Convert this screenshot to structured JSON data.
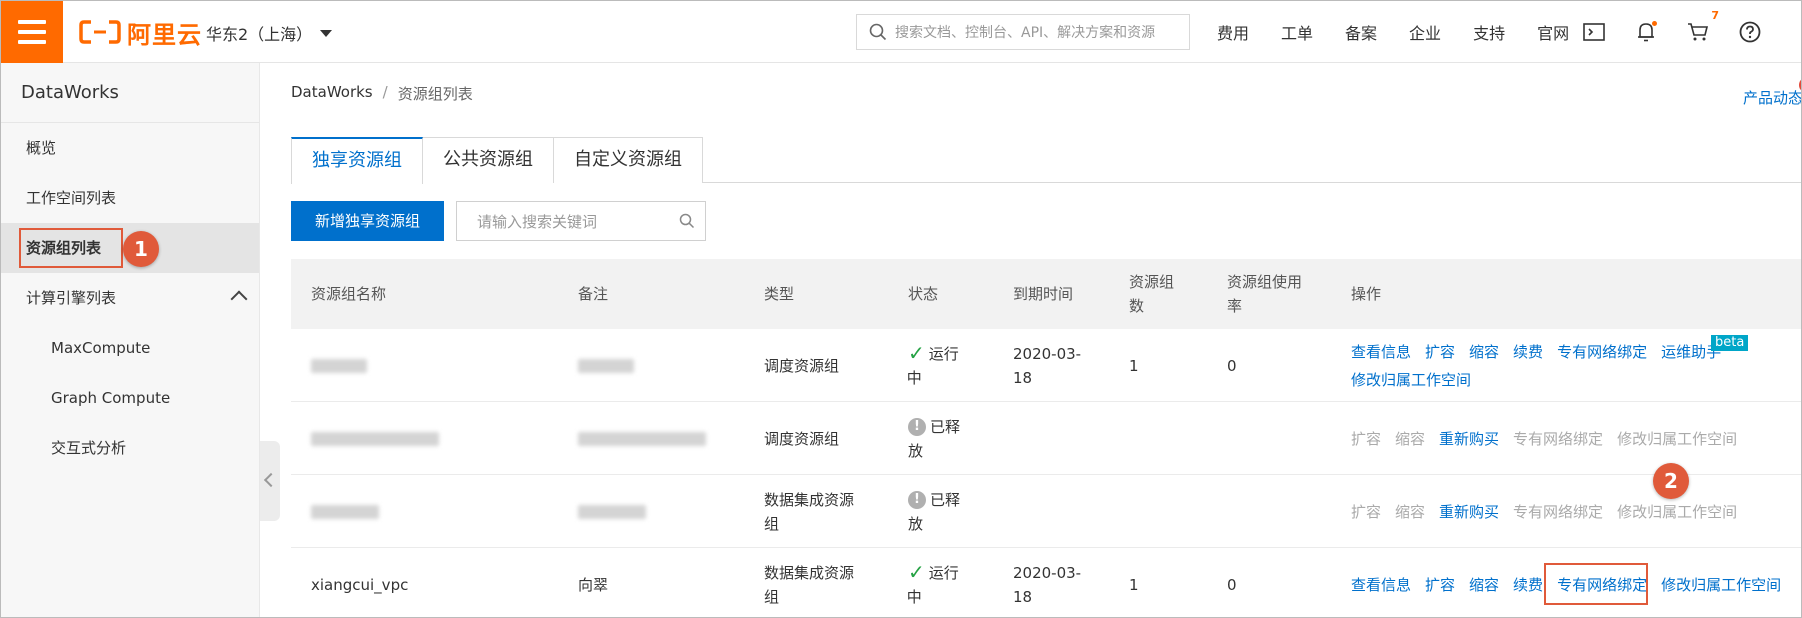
{
  "topbar": {
    "brand": "阿里云",
    "region": "华东2（上海）",
    "search_placeholder": "搜索文档、控制台、API、解决方案和资源",
    "nav_links": [
      "费用",
      "工单",
      "备案",
      "企业",
      "支持",
      "官网"
    ],
    "cart_count": "7",
    "brand_color": "#ff6a00"
  },
  "sidebar": {
    "title": "DataWorks",
    "items": [
      {
        "label": "概览"
      },
      {
        "label": "工作空间列表"
      },
      {
        "label": "资源组列表"
      },
      {
        "label": "计算引擎列表"
      },
      {
        "label": "MaxCompute"
      },
      {
        "label": "Graph Compute"
      },
      {
        "label": "交互式分析"
      }
    ],
    "active_item": "资源组列表"
  },
  "annotations": {
    "step1": "1",
    "step2": "2",
    "highlight_color": "#e05a3a"
  },
  "breadcrumb": {
    "root": "DataWorks",
    "sep": "/",
    "current": "资源组列表"
  },
  "product_news": "产品动态",
  "tabs": [
    "独享资源组",
    "公共资源组",
    "自定义资源组"
  ],
  "toolbar": {
    "add_button": "新增独享资源组",
    "search_placeholder": "请输入搜索关键词"
  },
  "table": {
    "headers": {
      "name": "资源组名称",
      "note": "备注",
      "type": "类型",
      "status": "状态",
      "expire": "到期时间",
      "count_l1": "资源组",
      "count_l2": "数",
      "usage_l1": "资源组使用",
      "usage_l2": "率",
      "ops": "操作"
    },
    "rows": [
      {
        "name": "",
        "note": "",
        "type": "调度资源组",
        "status_l1": "运行",
        "status_l2": "中",
        "status_icon": "check-icon",
        "expire_l1": "2020-03-",
        "expire_l2": "18",
        "count": "1",
        "usage": "0",
        "ops": [
          "查看信息",
          "扩容",
          "缩容",
          "续费",
          "专有网络绑定",
          "运维助手",
          "修改归属工作空间"
        ],
        "beta": "beta"
      },
      {
        "name": "",
        "note": "",
        "type": "调度资源组",
        "status_l1": "已释",
        "status_l2": "放",
        "status_icon": "info-icon",
        "ops_disabled": [
          "扩容",
          "缩容"
        ],
        "ops_link": "重新购买",
        "ops_disabled2": [
          "专有网络绑定",
          "修改归属工作空间"
        ]
      },
      {
        "name": "",
        "note": "",
        "type_l1": "数据集成资源",
        "type_l2": "组",
        "status_l1": "已释",
        "status_l2": "放",
        "status_icon": "info-icon",
        "ops_disabled": [
          "扩容",
          "缩容"
        ],
        "ops_link": "重新购买",
        "ops_disabled2": [
          "专有网络绑定",
          "修改归属工作空间"
        ]
      },
      {
        "name": "xiangcui_vpc",
        "note": "向翠",
        "type_l1": "数据集成资源",
        "type_l2": "组",
        "status_l1": "运行",
        "status_l2": "中",
        "status_icon": "check-icon",
        "expire_l1": "2020-03-",
        "expire_l2": "18",
        "count": "1",
        "usage": "0",
        "ops": [
          "查看信息",
          "扩容",
          "缩容",
          "续费",
          "专有网络绑定",
          "修改归属工作空间"
        ]
      }
    ]
  }
}
